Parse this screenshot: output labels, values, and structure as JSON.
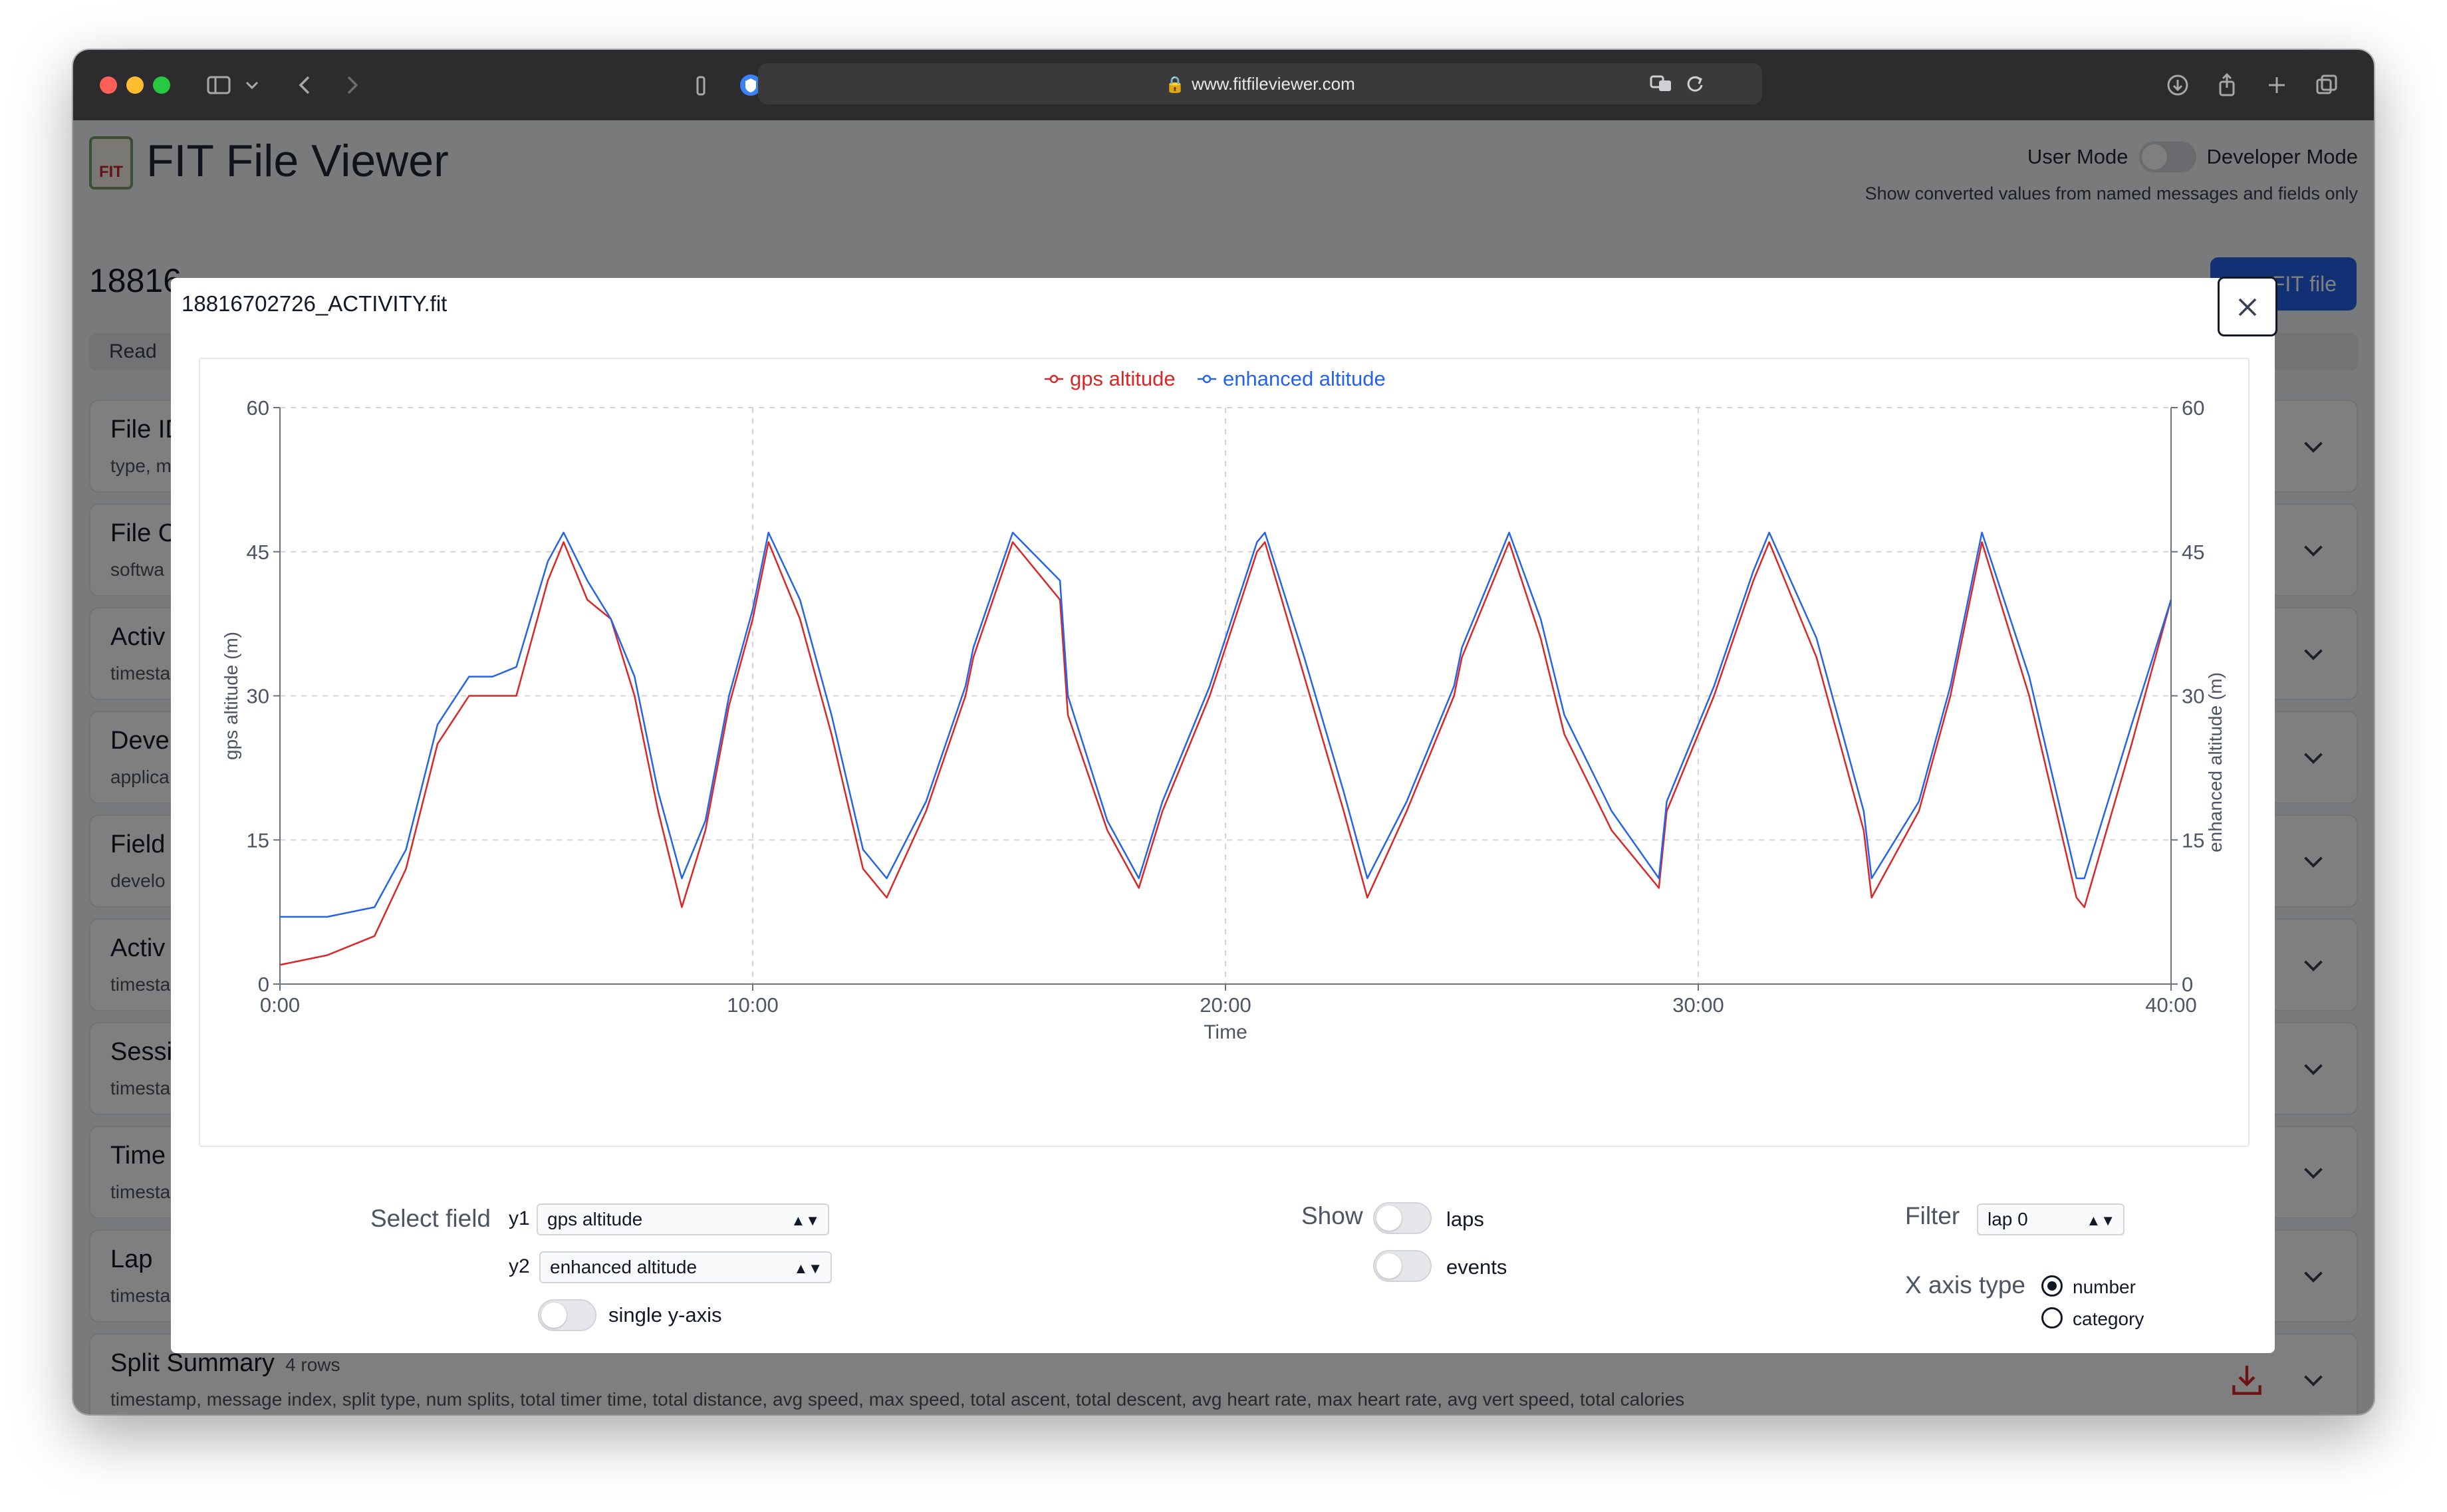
{
  "browser": {
    "url": "www.fitfileviewer.com"
  },
  "app": {
    "logo_text": "FIT",
    "title": "FIT File Viewer",
    "mode": {
      "user_label": "User Mode",
      "developer_label": "Developer Mode",
      "description": "Show converted values from named messages and fields only"
    },
    "file_heading": "18816",
    "open_button_label": "FIT file",
    "read_bar_text": "Read"
  },
  "sections": [
    {
      "title": "File ID",
      "count": "",
      "desc": "type, m"
    },
    {
      "title": "File C",
      "count": "",
      "desc": "softwa"
    },
    {
      "title": "Activ",
      "count": "",
      "desc": "timesta"
    },
    {
      "title": "Deve",
      "count": "",
      "desc": "applica"
    },
    {
      "title": "Field",
      "count": "",
      "desc": "develo"
    },
    {
      "title": "Activ",
      "count": "",
      "desc": "timesta"
    },
    {
      "title": "Sessi",
      "count": "",
      "desc": "timesta"
    },
    {
      "title": "Time",
      "count": "",
      "desc": "timesta"
    },
    {
      "title": "Lap",
      "count": "",
      "desc": "timesta"
    },
    {
      "title": "Split Summary",
      "count": "4 rows",
      "desc": "timestamp, message index, split type, num splits, total timer time, total distance, avg speed, max speed, total ascent, total descent, avg heart rate, max heart rate, avg vert speed, total calories"
    }
  ],
  "modal": {
    "title": "18816702726_ACTIVITY.fit"
  },
  "controls": {
    "select_field_label": "Select field",
    "y1_label": "y1",
    "y1_value": "gps altitude",
    "y2_label": "y2",
    "y2_value": "enhanced altitude",
    "single_axis_label": "single y-axis",
    "show_label": "Show",
    "laps_label": "laps",
    "events_label": "events",
    "filter_label": "Filter",
    "filter_value": "lap 0",
    "x_axis_type_label": "X axis type",
    "x_axis_number_label": "number",
    "x_axis_category_label": "category"
  },
  "chart_data": {
    "type": "line",
    "xlabel": "Time",
    "ylabel": "gps altitude (m)",
    "y2label": "enhanced altitude (m)",
    "xlim": [
      0,
      2400
    ],
    "x_ticks": [
      "0:00",
      "10:00",
      "20:00",
      "30:00",
      "40:00"
    ],
    "x_tick_values": [
      0,
      600,
      1200,
      1800,
      2400
    ],
    "ylim": [
      0,
      60
    ],
    "y_ticks": [
      "0",
      "15",
      "30",
      "45",
      "60"
    ],
    "y_tick_values": [
      0,
      15,
      30,
      45,
      60
    ],
    "grid": true,
    "legend_position": "top-center",
    "series": [
      {
        "name": "gps altitude",
        "color": "#dc2626",
        "axis": "y1",
        "x": [
          0,
          60,
          120,
          160,
          200,
          240,
          270,
          300,
          340,
          360,
          390,
          420,
          450,
          480,
          510,
          540,
          570,
          600,
          620,
          660,
          700,
          740,
          770,
          820,
          870,
          880,
          930,
          990,
          1000,
          1050,
          1090,
          1120,
          1180,
          1240,
          1250,
          1300,
          1350,
          1380,
          1430,
          1490,
          1500,
          1560,
          1600,
          1630,
          1690,
          1750,
          1760,
          1820,
          1870,
          1890,
          1950,
          2010,
          2020,
          2080,
          2120,
          2160,
          2220,
          2280,
          2290,
          2350,
          2400
        ],
        "values": [
          2,
          3,
          5,
          12,
          25,
          30,
          30,
          30,
          42,
          46,
          40,
          38,
          30,
          18,
          8,
          16,
          29,
          38,
          46,
          38,
          26,
          12,
          9,
          18,
          30,
          34,
          46,
          40,
          28,
          16,
          10,
          18,
          30,
          45,
          46,
          32,
          18,
          9,
          18,
          30,
          34,
          46,
          36,
          26,
          16,
          10,
          18,
          30,
          42,
          46,
          34,
          16,
          9,
          18,
          30,
          46,
          30,
          9,
          8,
          25,
          40
        ]
      },
      {
        "name": "enhanced altitude",
        "color": "#2563eb",
        "axis": "y2",
        "x": [
          0,
          60,
          120,
          160,
          200,
          240,
          270,
          300,
          340,
          360,
          390,
          420,
          450,
          480,
          510,
          540,
          570,
          600,
          620,
          660,
          700,
          740,
          770,
          820,
          870,
          880,
          930,
          990,
          1000,
          1050,
          1090,
          1120,
          1180,
          1240,
          1250,
          1300,
          1350,
          1380,
          1430,
          1490,
          1500,
          1560,
          1600,
          1630,
          1690,
          1750,
          1760,
          1820,
          1870,
          1890,
          1950,
          2010,
          2020,
          2080,
          2120,
          2160,
          2220,
          2280,
          2290,
          2350,
          2400
        ],
        "values": [
          7,
          7,
          8,
          14,
          27,
          32,
          32,
          33,
          44,
          47,
          42,
          38,
          32,
          20,
          11,
          17,
          30,
          39,
          47,
          40,
          28,
          14,
          11,
          19,
          31,
          35,
          47,
          42,
          30,
          17,
          11,
          19,
          31,
          46,
          47,
          34,
          20,
          11,
          19,
          31,
          35,
          47,
          38,
          28,
          18,
          11,
          19,
          31,
          43,
          47,
          36,
          18,
          11,
          19,
          31,
          47,
          32,
          11,
          11,
          27,
          40
        ]
      }
    ]
  }
}
